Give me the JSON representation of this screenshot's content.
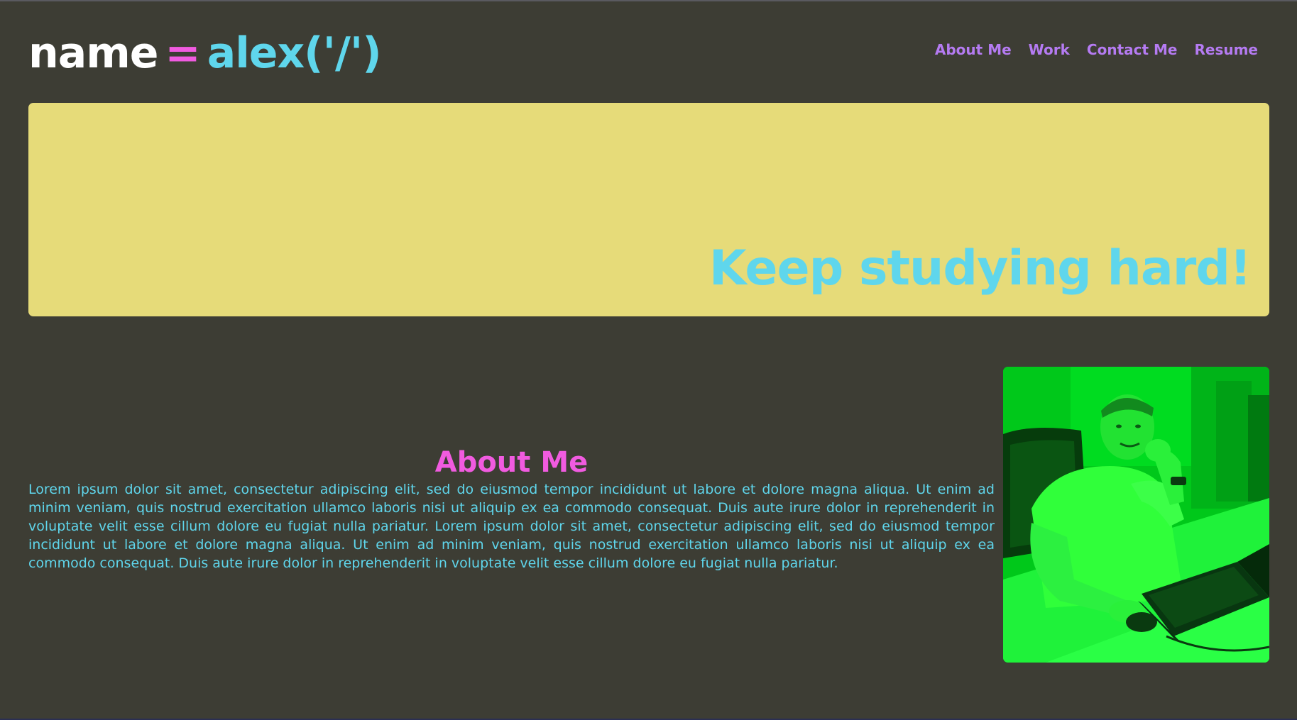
{
  "header": {
    "logo": {
      "keyword": "name",
      "operator": "=",
      "value": "alex('/')"
    },
    "nav": [
      {
        "label": "About Me"
      },
      {
        "label": "Work"
      },
      {
        "label": "Contact Me"
      },
      {
        "label": "Resume"
      }
    ]
  },
  "hero": {
    "headline": "Keep studying hard!"
  },
  "about": {
    "title": "About Me",
    "body": "Lorem ipsum dolor sit amet, consectetur adipiscing elit, sed do eiusmod tempor incididunt ut labore et dolore magna aliqua. Ut enim ad minim veniam, quis nostrud exercitation ullamco laboris nisi ut aliquip ex ea commodo consequat. Duis aute irure dolor in reprehenderit in voluptate velit esse cillum dolore eu fugiat nulla pariatur. Lorem ipsum dolor sit amet, consectetur adipiscing elit, sed do eiusmod tempor incididunt ut labore et dolore magna aliqua. Ut enim ad minim veniam, quis nostrud exercitation ullamco laboris nisi ut aliquip ex ea commodo consequat. Duis aute irure dolor in reprehenderit in voluptate velit esse cillum dolore eu fugiat nulla pariatur."
  },
  "colors": {
    "background": "#3d3d34",
    "hero_bg": "#e6db79",
    "accent_cyan": "#5fd6ec",
    "accent_pink": "#f15be0",
    "accent_purple": "#b57bf2",
    "photo_tint": "#00d21c"
  }
}
